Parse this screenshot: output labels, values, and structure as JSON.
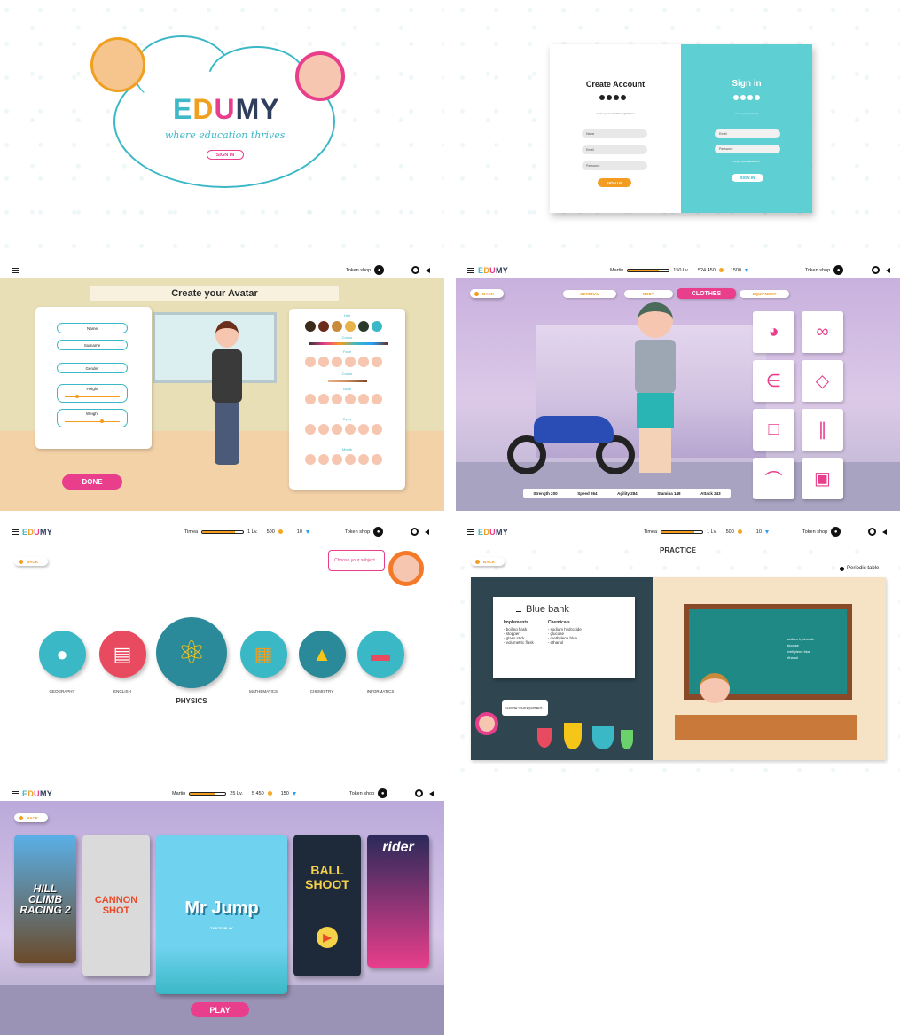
{
  "brand": {
    "e": "E",
    "d": "D",
    "u": "U",
    "my": "MY"
  },
  "colors": {
    "teal": "#3bb8c6",
    "pink": "#e83e8c",
    "orange": "#f39c1f",
    "navy": "#2e3e5c"
  },
  "landing": {
    "tagline": "where education thrives",
    "signin_label": "SIGN IN"
  },
  "auth": {
    "create_title": "Create Account",
    "create_note": "or use your email for registration",
    "name_placeholder": "Name",
    "email_placeholder": "Email",
    "password_placeholder": "Password",
    "signup_label": "SIGN UP",
    "signin_title": "Sign in",
    "signin_note": "or use your account",
    "signin_email": "Email",
    "signin_password": "Password",
    "forgot": "Forgot your password?",
    "signin_button": "SIGN IN"
  },
  "common": {
    "token_shop": "Token shop",
    "back": "BACK"
  },
  "avatar": {
    "title": "Create your Avatar",
    "fields": [
      "Name",
      "Surname",
      "Gender",
      "Height",
      "Weight"
    ],
    "sections": [
      "Hair",
      "Colour",
      "Face",
      "Colour",
      "Nose",
      "Eyes",
      "Mouth"
    ],
    "done": "DONE"
  },
  "wardrobe": {
    "player": "Martin",
    "level": "150 Lv.",
    "coins": "524 450",
    "gems": "1500",
    "level_fill": 0.75,
    "tabs": [
      "GENERAL",
      "BODY",
      "CLOTHES",
      "EQUIPMENT"
    ],
    "stats": [
      "Strength 200",
      "Speed 264",
      "Agility 284",
      "Stamina 148",
      "Attack 243"
    ]
  },
  "subjects": {
    "player": "Timea",
    "level": "1 Lv.",
    "coins": "500",
    "gems": "10",
    "level_fill": 0.8,
    "prompt": "Choose your subject...",
    "items": [
      {
        "label": "GEOGRAPHY",
        "color": "#3bb8c6"
      },
      {
        "label": "ENGLISH",
        "color": "#e84a5f"
      },
      {
        "label": "PHYSICS",
        "color": "#2a8a9a"
      },
      {
        "label": "MATHEMATICS",
        "color": "#3bb8c6"
      },
      {
        "label": "CHEMISTRY",
        "color": "#2a8a9a"
      },
      {
        "label": "INFORMATICS",
        "color": "#3bb8c6"
      }
    ]
  },
  "practice": {
    "player": "Timea",
    "level": "1 Lv.",
    "coins": "500",
    "gems": "10",
    "level_fill": 0.8,
    "title": "PRACTICE",
    "periodic": "Periodic table",
    "bank_title": "Blue bank",
    "implements_title": "Implements",
    "implements": [
      "- boiling flask",
      "- stopper",
      "- glass stick",
      "- volumetric flask"
    ],
    "chemicals_title": "Chemicals",
    "chemicals": [
      "- sodium hydroxide",
      "- glucose",
      "- methylene blue",
      "- ethanol"
    ],
    "board": [
      "sodium hydroxide",
      "glucose",
      "methylene blue",
      "ethanol"
    ],
    "prompt": "CHOOSE YOUR EQUIPMENT..."
  },
  "games": {
    "player": "Martin",
    "level": "25 Lv.",
    "coins": "5 450",
    "gems": "150",
    "level_fill": 0.7,
    "cards": [
      "HILL CLIMB RACING 2",
      "CANNON SHOT",
      "Mr Jump",
      "BALL SHOOT",
      "rider"
    ],
    "tap": "TAP TO PLAY",
    "play": "PLAY"
  }
}
